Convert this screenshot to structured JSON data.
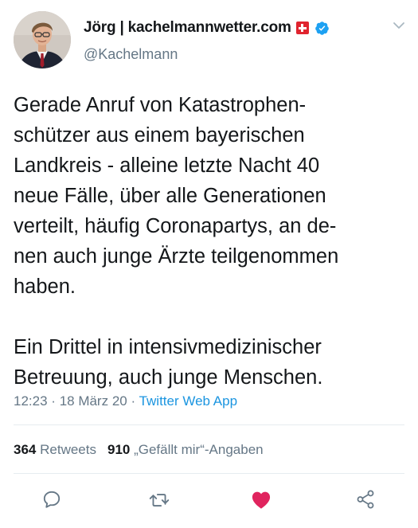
{
  "author": {
    "display_name": "Jörg | kachelmannwetter.com",
    "handle": "@Kachelmann",
    "badges": [
      "swiss-flag-icon",
      "verified-icon"
    ]
  },
  "tweet": {
    "lines": [
      "Gerade Anruf von Katastrophen-",
      "schützer aus einem bayerischen",
      "Landkreis - alleine letzte Nacht 40",
      "neue Fälle, über alle Generationen",
      "verteilt, häufig Coronapartys, an de-",
      "nen auch junge Ärzte teilgenommen",
      "haben.",
      "",
      "Ein Drittel in intensivmedizinischer",
      "Betreuung, auch junge Menschen."
    ],
    "time": "12:23",
    "date": "18 März 20",
    "separator": "·",
    "source": "Twitter Web App"
  },
  "stats": {
    "retweets_count": "364",
    "retweets_label": "Retweets",
    "likes_count": "910",
    "likes_label": "„Gefällt mir“-Angaben"
  },
  "actions": [
    "reply-icon",
    "retweet-icon",
    "like-icon",
    "share-icon"
  ],
  "colors": {
    "text": "#14171a",
    "secondary": "#657786",
    "link": "#1b95e0",
    "verified": "#1da1f2",
    "like": "#e0245e",
    "flag": "#e0242f",
    "divider": "#e6ecf0"
  }
}
